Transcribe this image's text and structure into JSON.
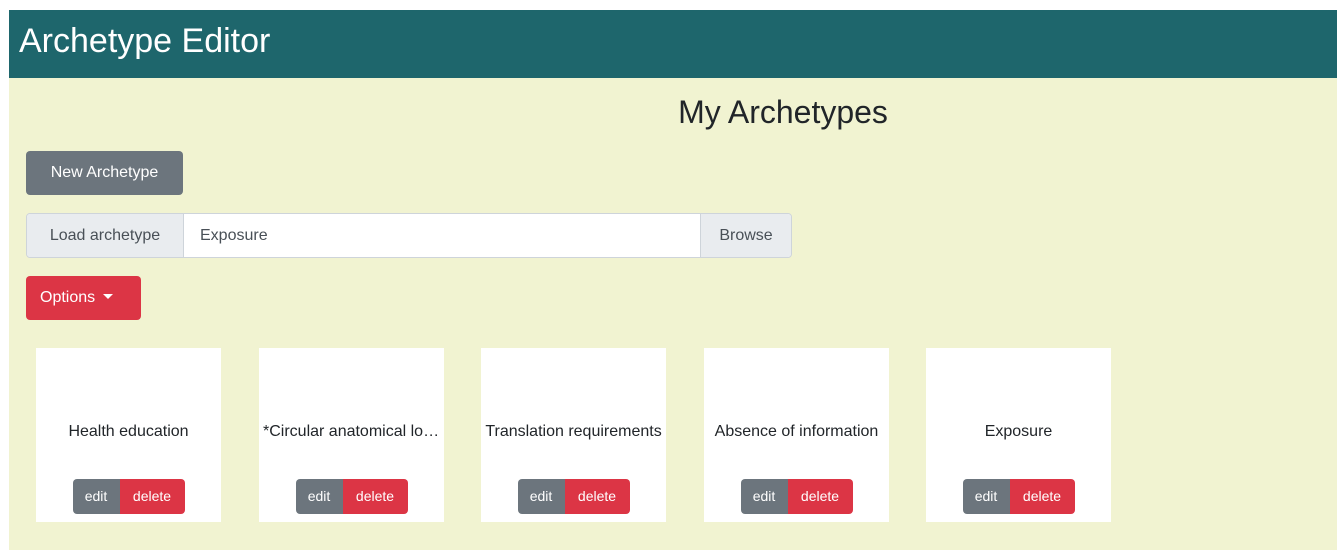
{
  "navbar": {
    "brand": "Archetype Editor"
  },
  "page": {
    "title": "My Archetypes"
  },
  "toolbar": {
    "new_archetype_label": "New Archetype",
    "load_label": "Load archetype",
    "load_value": "Exposure",
    "browse_label": "Browse",
    "options_label": "Options"
  },
  "cards": [
    {
      "title": "Health education",
      "edit_label": "edit",
      "delete_label": "delete"
    },
    {
      "title": "*Circular anatomical location",
      "edit_label": "edit",
      "delete_label": "delete"
    },
    {
      "title": "Translation requirements",
      "edit_label": "edit",
      "delete_label": "delete"
    },
    {
      "title": "Absence of information",
      "edit_label": "edit",
      "delete_label": "delete"
    },
    {
      "title": "Exposure",
      "edit_label": "edit",
      "delete_label": "delete"
    }
  ],
  "colors": {
    "navbar": "#1e666c",
    "background": "#f1f3d1",
    "secondary": "#6c757d",
    "danger": "#dc3545"
  },
  "icons": {
    "options_caret": "caret-down-icon"
  }
}
